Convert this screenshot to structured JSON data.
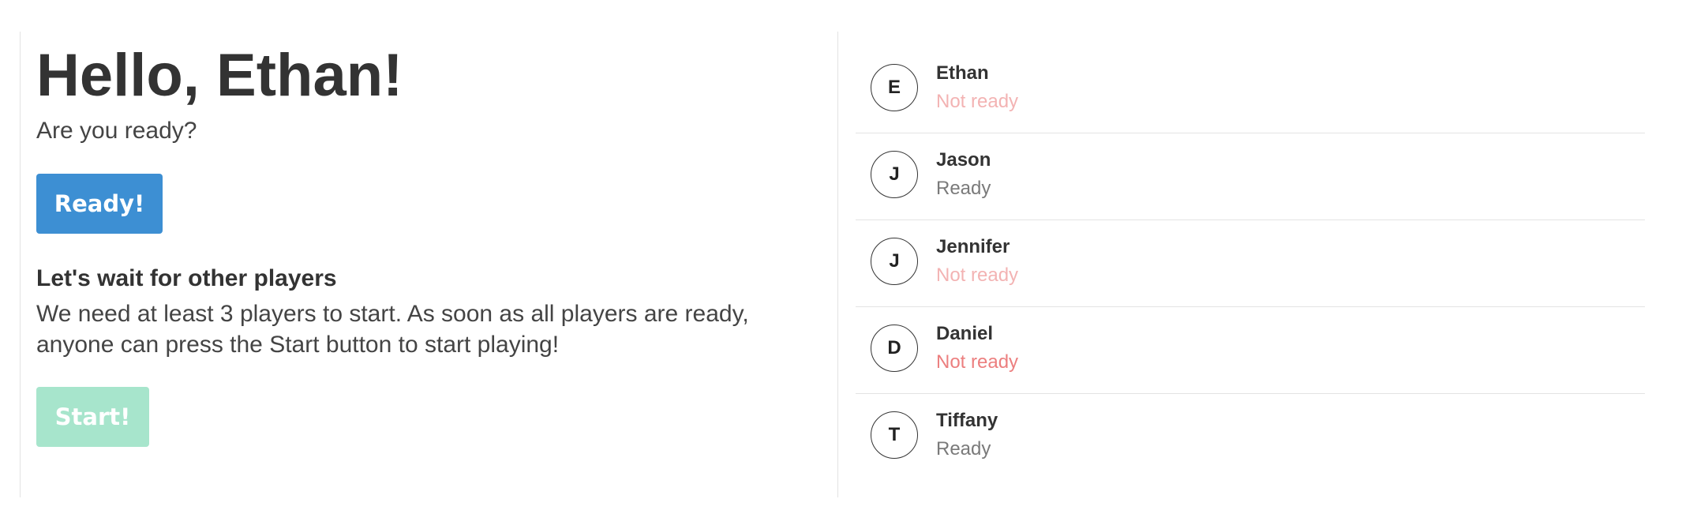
{
  "greeting": {
    "title": "Hello, Ethan!",
    "subtitle": "Are you ready?"
  },
  "ready_button": {
    "label": "Ready!",
    "color": "#3d8fd3"
  },
  "waiting": {
    "title": "Let's wait for other players",
    "text": "We need at least 3 players to start. As soon as all players are ready, anyone can press the Start button to start playing!"
  },
  "start_button": {
    "label": "Start!",
    "color": "#a7e5cc",
    "enabled": false
  },
  "players": [
    {
      "initial": "E",
      "name": "Ethan",
      "status": "Not ready",
      "status_color": "#f3b3b3"
    },
    {
      "initial": "J",
      "name": "Jason",
      "status": "Ready",
      "status_color": "#7a7a7a"
    },
    {
      "initial": "J",
      "name": "Jennifer",
      "status": "Not ready",
      "status_color": "#f3b3b3"
    },
    {
      "initial": "D",
      "name": "Daniel",
      "status": "Not ready",
      "status_color": "#ec7f7f"
    },
    {
      "initial": "T",
      "name": "Tiffany",
      "status": "Ready",
      "status_color": "#7a7a7a"
    }
  ]
}
